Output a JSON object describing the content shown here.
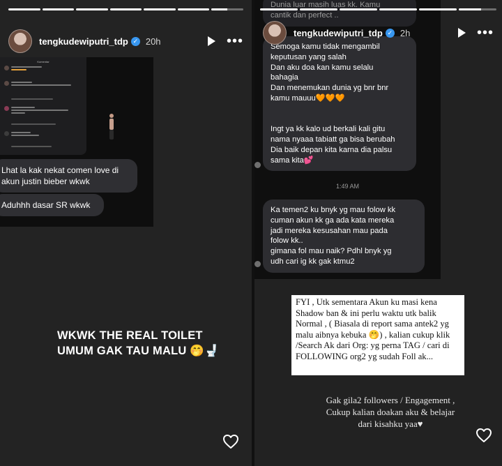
{
  "left": {
    "username": "tengkudewiputri_tdp",
    "verified_glyph": "✓",
    "time": "20h",
    "progress": [
      1,
      1,
      1,
      1,
      1,
      1,
      0.5
    ],
    "mini_header": "Komentar",
    "bubble1": "Lhat la kak nekat comen love di akun justin bieber wkwk",
    "bubble2": "Aduhhh dasar SR wkwk",
    "caption_line1": "WKWK THE REAL TOILET",
    "caption_line2": "UMUM GAK TAU MALU 🤭🚽",
    "icons": {
      "play": "play-icon",
      "more": "more-icon",
      "like": "heart-icon"
    }
  },
  "right": {
    "username": "tengkudewiputri_tdp",
    "verified_glyph": "✓",
    "time": "2h",
    "progress": [
      1,
      1,
      1,
      1,
      1,
      0.6
    ],
    "top_partial": "Dunia luar masih luas kk. Kamu\ncantik dan perfect ..",
    "message1": "Semoga kamu tidak mengambil\nkeputusan yang salah\nDan aku doa kan kamu selalu\nbahagia\nDan menemukan dunia yg bnr bnr\nkamu mauuu🧡🧡🧡\n\n\nIngt ya kk kalo ud berkali kali gitu\nnama nyaaa tabiatt ga bisa berubah\nDia baik depan kita karna dia palsu\nsama kita💕",
    "timestamp": "1:49 AM",
    "message2": "Ka temen2 ku bnyk yg mau folow kk\ncuman akun kk ga ada kata mereka\njadi mereka kesusahan mau pada\nfolow kk..\ngimana fol mau naik? Pdhl bnyk yg\nudh cari ig kk gak ktmu2",
    "notice": "FYI  , Utk sementara Akun ku masi kena Shadow ban & ini perlu waktu utk balik Normal  , ( Biasala di report sama antek2 yg malu aibnya kebuka 🤭) , kalian cukup klik /Search Ak dari Org: yg perna TAG / cari di FOLLOWING org2 yg sudah Foll ak...",
    "caption": "Gak gila2 followers / Engagement , Cukup kalian doakan aku & belajar dari kisahku yaa♥",
    "icons": {
      "play": "play-icon",
      "more": "more-icon",
      "like": "heart-icon"
    }
  }
}
